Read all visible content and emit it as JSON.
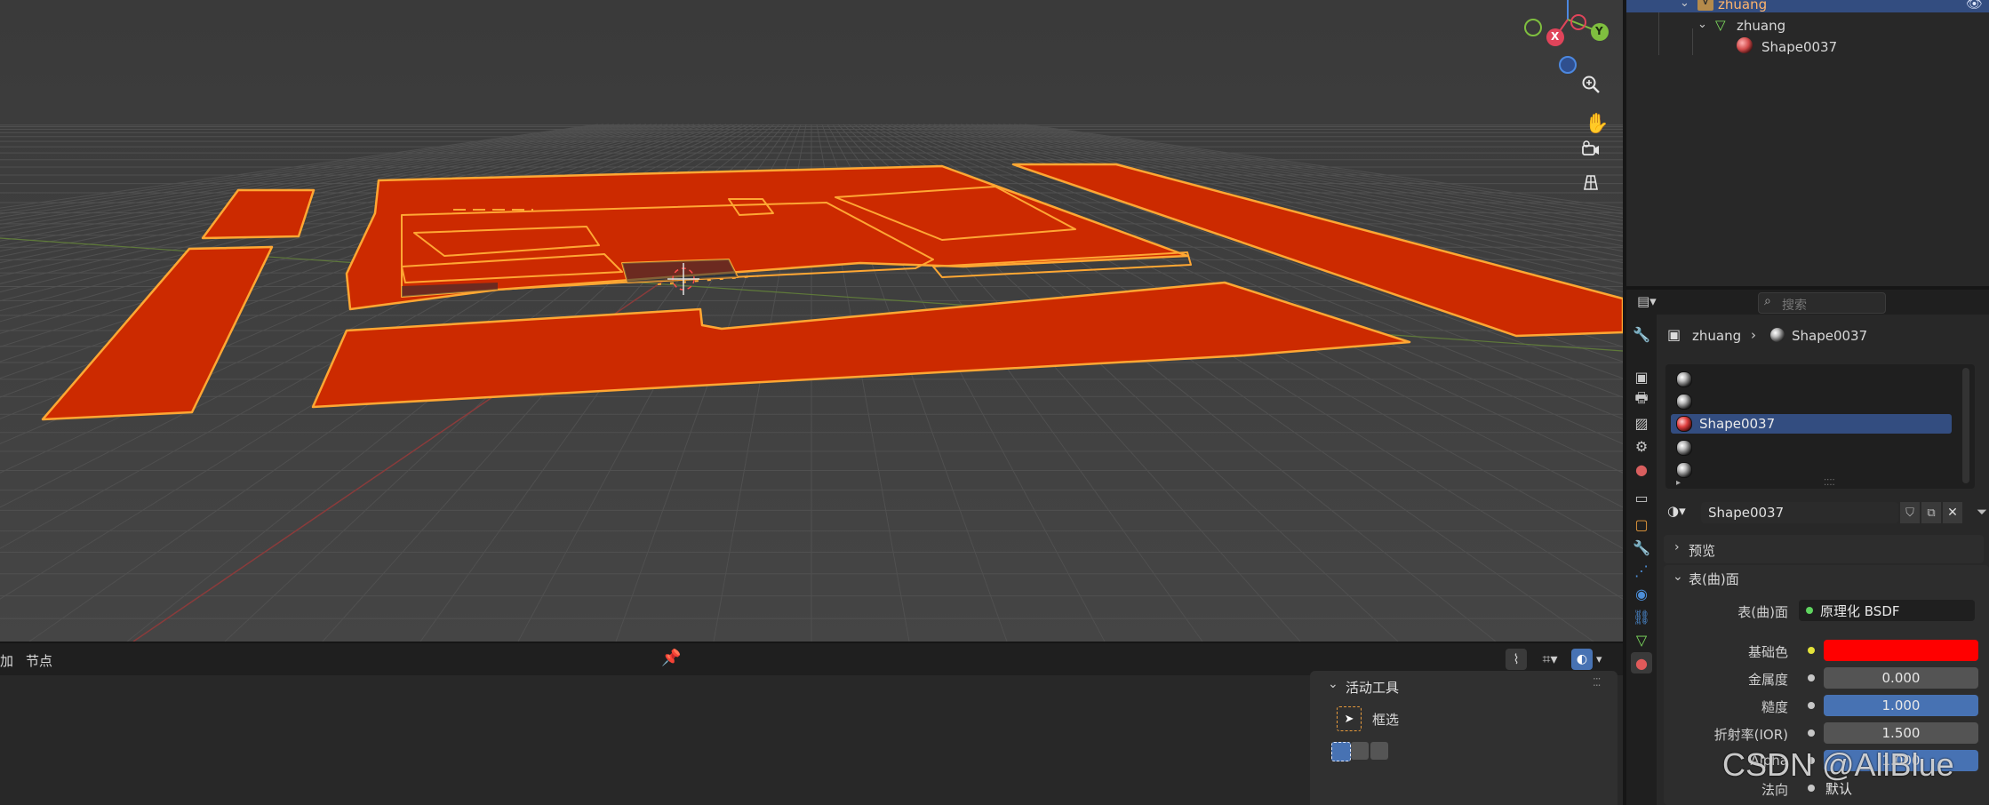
{
  "outliner": {
    "items": [
      {
        "label": "zhuang"
      },
      {
        "label": "zhuang"
      },
      {
        "label": "Shape0037"
      }
    ]
  },
  "viewport": {
    "gizmo": {
      "x": "X",
      "y": "Y"
    }
  },
  "bottom_editor": {
    "menu_add": "加",
    "menu_node": "节点"
  },
  "tool_panel": {
    "title": "活动工具",
    "tool_name": "框选"
  },
  "properties": {
    "search_placeholder": "搜索",
    "breadcrumb": {
      "object": "zhuang",
      "material": "Shape0037"
    },
    "material_slots": [
      "",
      "",
      "Shape0037",
      "",
      ""
    ],
    "active_slot_index": 2,
    "material_name": "Shape0037",
    "panels": {
      "preview": "预览",
      "surface": "表(曲)面"
    },
    "surface": {
      "label": "表(曲)面",
      "shader": "原理化 BSDF"
    },
    "params": [
      {
        "label": "基础色",
        "value": "",
        "kind": "color",
        "color": "#ff0000"
      },
      {
        "label": "金属度",
        "value": "0.000",
        "kind": "slider",
        "fill": 0.0
      },
      {
        "label": "糙度",
        "value": "1.000",
        "kind": "slider",
        "fill": 1.0
      },
      {
        "label": "折射率(IOR)",
        "value": "1.500",
        "kind": "slider",
        "fill": 0.0
      },
      {
        "label": "Alpha",
        "value": "1.000",
        "kind": "slider",
        "fill": 1.0
      },
      {
        "label": "法向",
        "value": "默认",
        "kind": "text"
      }
    ]
  },
  "watermark": "CSDN @AllBlue",
  "colors": {
    "mesh_fill": "#cc2a00",
    "mesh_outline": "#ffa733",
    "accent_blue": "#4772b3",
    "base_color": "#ff0000",
    "selected_row": "#334d80"
  }
}
